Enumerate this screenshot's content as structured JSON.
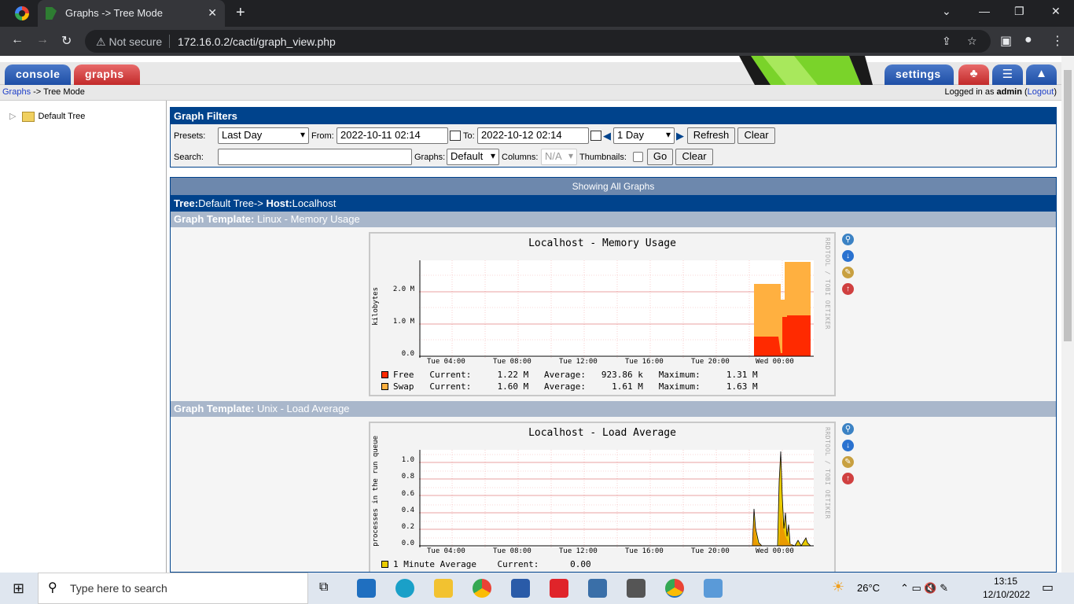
{
  "browser": {
    "tab_title": "Graphs -> Tree Mode",
    "tab_close": "✕",
    "new_tab": "+",
    "not_secure": "Not secure",
    "url": "172.16.0.2/cacti/graph_view.php"
  },
  "cacti": {
    "tabs": {
      "console": "console",
      "graphs": "graphs",
      "settings": "settings"
    },
    "breadcrumb": {
      "graphs_link": "Graphs",
      "sep": " -> ",
      "current": "Tree Mode"
    },
    "login": {
      "prefix": "Logged in as ",
      "user": "admin",
      "logout": "Logout"
    },
    "tree": {
      "root": "Default Tree"
    }
  },
  "filters": {
    "title": "Graph Filters",
    "presets_label": "Presets:",
    "presets_value": "Last Day",
    "from_label": "From:",
    "from_value": "2022-10-11 02:14",
    "to_label": "To:",
    "to_value": "2022-10-12 02:14",
    "span_value": "1 Day",
    "refresh": "Refresh",
    "clear": "Clear",
    "search_label": "Search:",
    "graphs_label": "Graphs:",
    "graphs_value": "Default",
    "columns_label": "Columns:",
    "columns_value": "N/A",
    "thumbnails_label": "Thumbnails:",
    "go": "Go",
    "clear2": "Clear"
  },
  "content": {
    "showing": "Showing All Graphs",
    "tree_label": "Tree:",
    "tree_value": "Default Tree-> ",
    "host_label": "Host:",
    "host_value": "Localhost",
    "template_label": "Graph Template:",
    "templates": [
      "Linux - Memory Usage",
      "Unix - Load Average"
    ]
  },
  "graphs": [
    {
      "title": "Localhost - Memory Usage",
      "credit": "RRDTOOL / TOBI OETIKER",
      "ylabel": "kilobytes",
      "yticks": [
        "2.0 M",
        "1.0 M",
        "0.0"
      ],
      "xticks": [
        "Tue 04:00",
        "Tue 08:00",
        "Tue 12:00",
        "Tue 16:00",
        "Tue 20:00",
        "Wed 00:00"
      ],
      "legend": [
        {
          "name": "Free",
          "color": "#ff2a00",
          "text": "Free   Current:     1.22 M   Average:   923.86 k   Maximum:     1.31 M"
        },
        {
          "name": "Swap",
          "color": "#ffb040",
          "text": "Swap   Current:     1.60 M   Average:     1.61 M   Maximum:     1.63 M"
        }
      ]
    },
    {
      "title": "Localhost - Load Average",
      "credit": "RRDTOOL / TOBI OETIKER",
      "ylabel": "processes in the run queue",
      "yticks": [
        "1.0",
        "0.8",
        "0.6",
        "0.4",
        "0.2",
        "0.0"
      ],
      "xticks": [
        "Tue 04:00",
        "Tue 08:00",
        "Tue 12:00",
        "Tue 16:00",
        "Tue 20:00",
        "Wed 00:00"
      ],
      "legend": [
        {
          "name": "1 Minute Average",
          "color": "#eacc00",
          "text": "1 Minute Average    Current:      0.00"
        }
      ]
    }
  ],
  "taskbar": {
    "search_placeholder": "Type here to search",
    "weather": "26°C",
    "time": "13:15",
    "date": "12/10/2022"
  },
  "colors": {
    "cacti_blue": "#00438c",
    "template_bar": "#a9b7cb",
    "showing_bar": "#6d88ad"
  }
}
